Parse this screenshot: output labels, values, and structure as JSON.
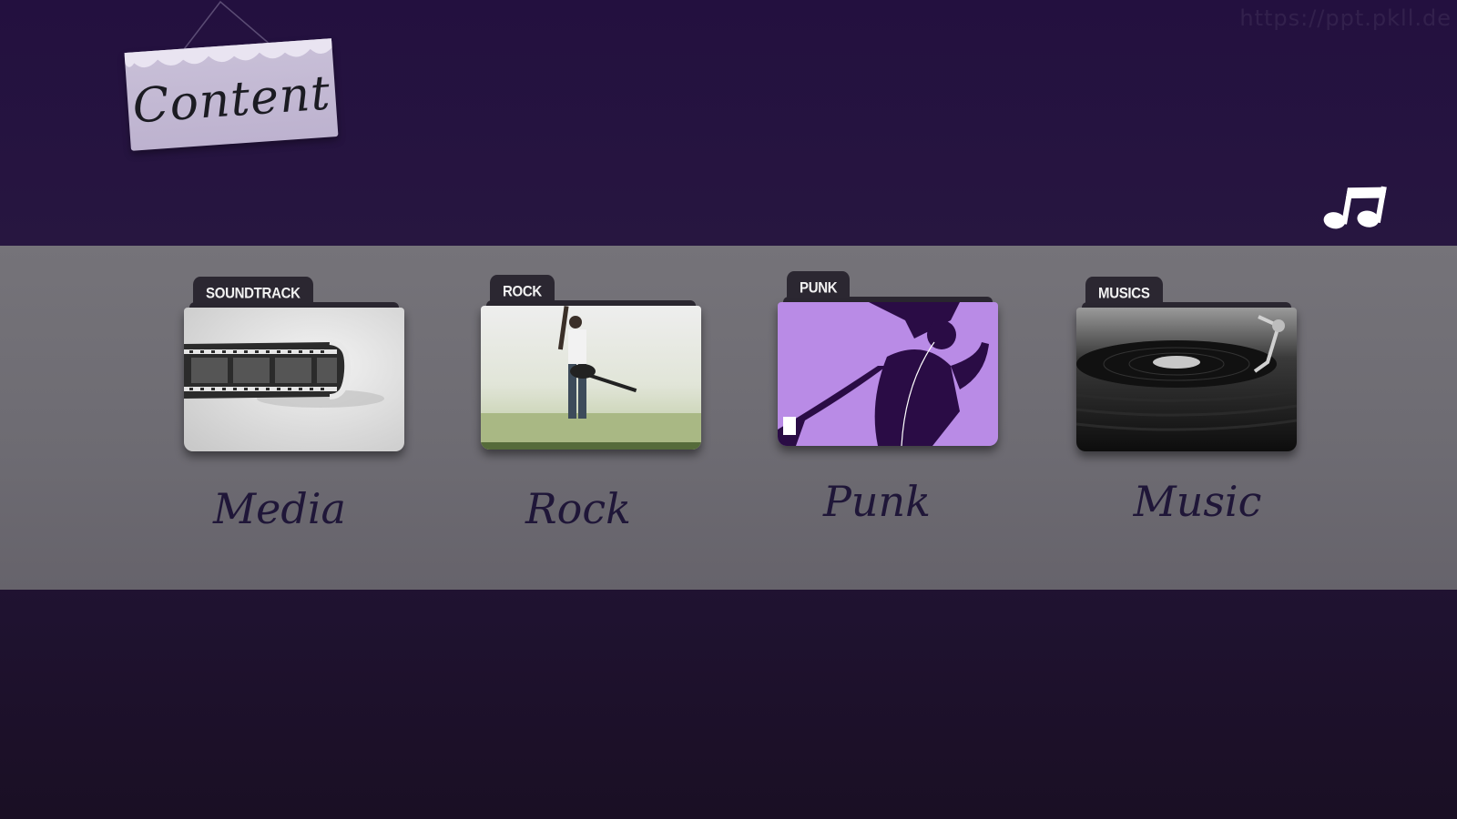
{
  "watermark": "https://ppt.pkll.de",
  "sign": {
    "title": "Content"
  },
  "corner_icon": "music-note-icon",
  "folders": [
    {
      "tab": "SOUNDTRACK",
      "label": "Media",
      "icon": "film-strip-image"
    },
    {
      "tab": "ROCK",
      "label": "Rock",
      "icon": "guitarist-image"
    },
    {
      "tab": "PUNK",
      "label": "Punk",
      "icon": "dancer-silhouette-image"
    },
    {
      "tab": "MUSICS",
      "label": "Music",
      "icon": "vinyl-turntable-image"
    }
  ],
  "colors": {
    "background_top": "#23103f",
    "band": "#6f6d74",
    "punk_accent": "#b98be6",
    "label_text": "#1f1638"
  }
}
